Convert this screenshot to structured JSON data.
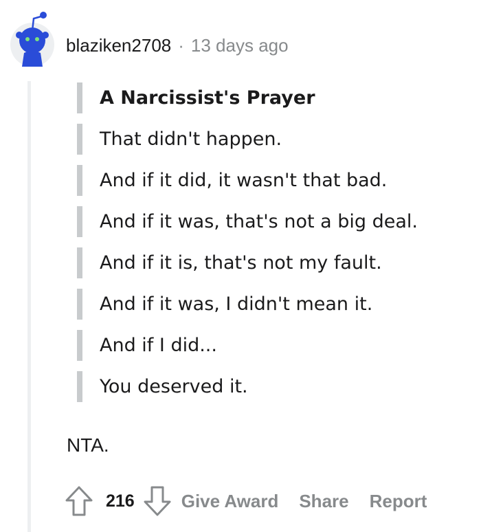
{
  "comment": {
    "username": "blaziken2708",
    "separator": "·",
    "timestamp": "13 days ago",
    "avatar_icon": "snoo-avatar-icon",
    "quote": {
      "title": "A Narcissist's Prayer",
      "lines": [
        "That didn't happen.",
        "And if it did, it wasn't that bad.",
        "And if it was, that's not a big deal.",
        "And if it is, that's not my fault.",
        "And if it was, I didn't mean it.",
        "And if I did...",
        "You deserved it."
      ]
    },
    "body": "NTA.",
    "actions": {
      "upvote_icon": "upvote-arrow-icon",
      "score": "216",
      "downvote_icon": "downvote-arrow-icon",
      "give_award": "Give Award",
      "share": "Share",
      "report": "Report"
    }
  },
  "colors": {
    "text": "#1a1a1b",
    "muted": "#878a8c",
    "avatar_blue": "#2a4cd8",
    "quote_bar": "#c8cbcd",
    "thread_line": "#edeff1"
  }
}
